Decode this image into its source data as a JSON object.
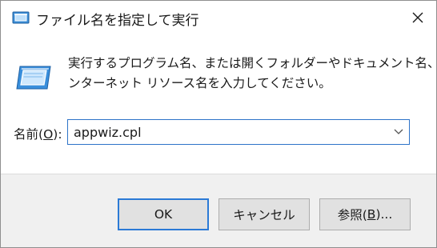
{
  "window": {
    "title": "ファイル名を指定して実行",
    "close_glyph": "✕",
    "icons": {
      "title": "run-icon",
      "close": "close-icon",
      "main": "run-icon"
    }
  },
  "description": {
    "line1": "実行するプログラム名、または開くフォルダーやドキュメント名、イ",
    "line2": "ンターネット リソース名を入力してください。"
  },
  "name_field": {
    "label_prefix": "名前(",
    "label_accel": "O",
    "label_suffix": "):",
    "value": "appwiz.cpl",
    "dropdown_icon": "chevron-down-icon"
  },
  "buttons": {
    "ok": "OK",
    "cancel": "キャンセル",
    "browse_prefix": "参照(",
    "browse_accel": "B",
    "browse_suffix": ")..."
  },
  "colors": {
    "accent": "#2b7ad6",
    "footer_bg": "#f0f0f0",
    "button_bg": "#e1e1e1"
  }
}
